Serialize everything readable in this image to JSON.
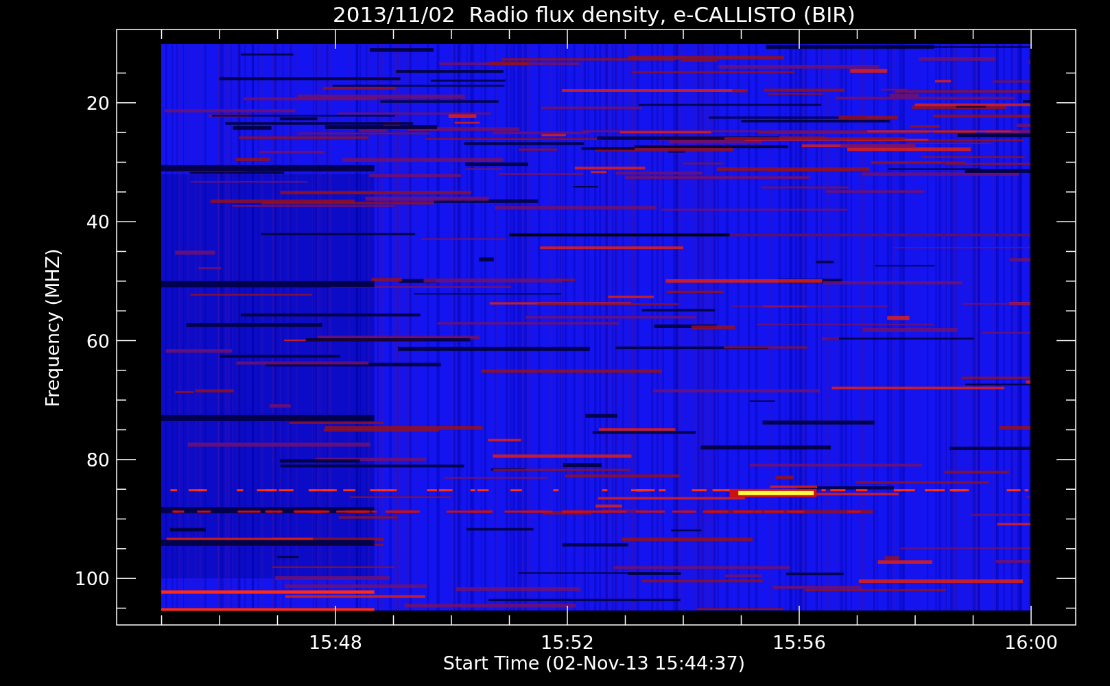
{
  "chart": {
    "title": "2013/11/02  Radio flux density, e-CALLISTO (BIR)",
    "xlabel": "Start Time (02-Nov-13 15:44:37)",
    "ylabel": "Frequency (MHZ)",
    "xtick_labels": [
      "15:48",
      "15:52",
      "15:56",
      "16:00"
    ],
    "ytick_labels": [
      "20",
      "40",
      "60",
      "80",
      "100"
    ]
  }
}
